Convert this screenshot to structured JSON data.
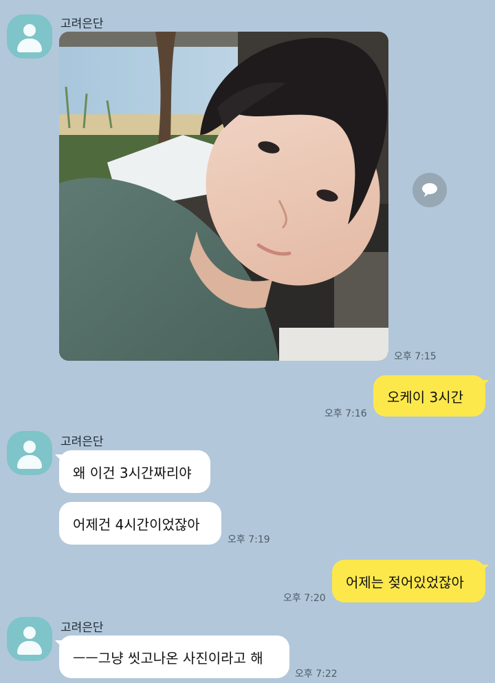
{
  "sender_name": "고려은단",
  "messages": [
    {
      "id": "m1",
      "direction": "in",
      "type": "photo",
      "photo_alt": "selfie photo",
      "time": "오후 7:15"
    },
    {
      "id": "m2",
      "direction": "out",
      "text": "오케이 3시간",
      "time": "오후 7:16"
    },
    {
      "id": "m3",
      "direction": "in",
      "text": "왜 이건 3시간짜리야"
    },
    {
      "id": "m4",
      "direction": "in",
      "text": "어제건 4시간이었잖아",
      "time": "오후 7:19"
    },
    {
      "id": "m5",
      "direction": "out",
      "text": "어제는 젖어있었잖아",
      "time": "오후 7:20"
    },
    {
      "id": "m6",
      "direction": "in",
      "text": "ㅡㅡ그냥 씻고나온 사진이라고 해",
      "time": "오후 7:22"
    }
  ],
  "colors": {
    "background": "#b2c7da",
    "incoming_bubble": "#ffffff",
    "outgoing_bubble": "#fde84c",
    "avatar": "#7ec4c9"
  },
  "icons": {
    "share": "share-speech-bubble-icon",
    "avatar": "default-profile-icon"
  }
}
